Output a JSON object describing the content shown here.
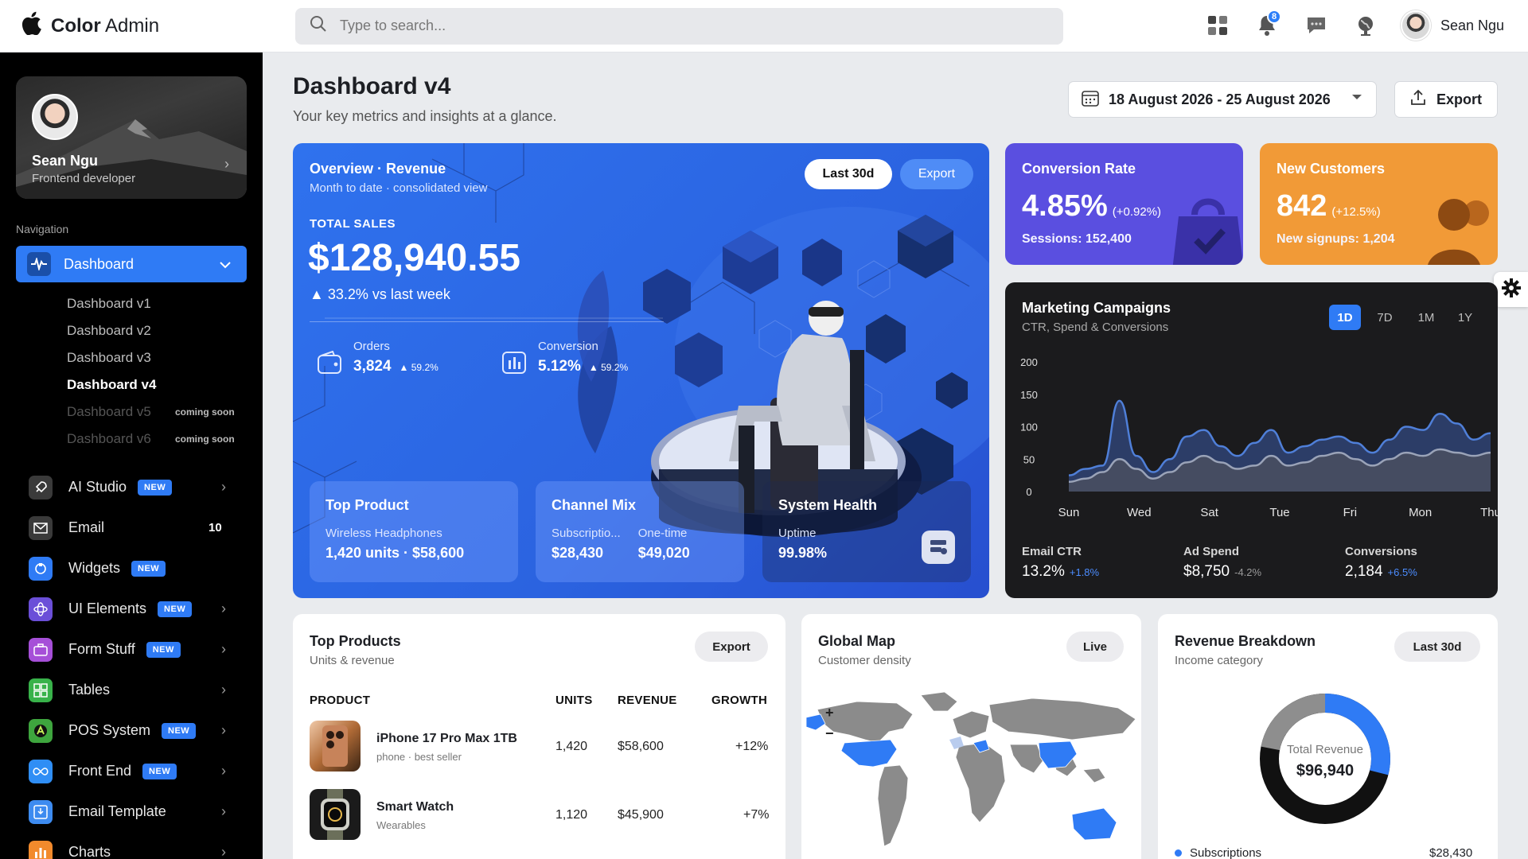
{
  "app": {
    "title_bold": "Color",
    "title_rest": "Admin"
  },
  "search": {
    "placeholder": "Type to search..."
  },
  "top": {
    "notifications_count": "8",
    "user_name": "Sean Ngu"
  },
  "sidebar": {
    "profile": {
      "name": "Sean Ngu",
      "role": "Frontend developer"
    },
    "nav_label": "Navigation",
    "active": {
      "label": "Dashboard"
    },
    "sub_items": [
      {
        "label": "Dashboard v1"
      },
      {
        "label": "Dashboard v2"
      },
      {
        "label": "Dashboard v3"
      },
      {
        "label": "Dashboard v4"
      },
      {
        "label": "Dashboard v5",
        "soon": "coming soon"
      },
      {
        "label": "Dashboard v6",
        "soon": "coming soon"
      }
    ],
    "menu": [
      {
        "label": "AI Studio",
        "badge": "NEW",
        "color": "#3a3a3a",
        "icon": "rocket-icon"
      },
      {
        "label": "Email",
        "count": "10",
        "color": "#3a3a3a",
        "icon": "envelope-icon"
      },
      {
        "label": "Widgets",
        "badge": "NEW",
        "color": "#2f7bf5",
        "icon": "widget-icon"
      },
      {
        "label": "UI Elements",
        "badge": "NEW",
        "color": "#6b4fd8",
        "icon": "atom-icon"
      },
      {
        "label": "Form Stuff",
        "badge": "NEW",
        "color": "#a64fd8",
        "icon": "briefcase-icon"
      },
      {
        "label": "Tables",
        "color": "#38b24a",
        "icon": "grid-icon"
      },
      {
        "label": "POS System",
        "badge": "NEW",
        "color": "#3ea53e",
        "icon": "pos-icon"
      },
      {
        "label": "Front End",
        "badge": "NEW",
        "color": "#2f8ef5",
        "icon": "infinity-icon"
      },
      {
        "label": "Email Template",
        "color": "#3d8bf0",
        "icon": "inbox-icon"
      },
      {
        "label": "Charts",
        "color": "#f28a2c",
        "icon": "chart-icon"
      }
    ],
    "labels": {
      "new": "NEW",
      "email_count": "10"
    }
  },
  "page": {
    "title": "Dashboard v4",
    "subtitle": "Your key metrics and insights at a glance.",
    "date_range": "18 August 2026 - 25 August 2026",
    "export": "Export"
  },
  "hero": {
    "title": "Overview · Revenue",
    "subtitle": "Month to date · consolidated view",
    "btn_primary": "Last 30d",
    "btn_secondary": "Export",
    "total_label": "TOTAL SALES",
    "total_value": "$128,940.55",
    "change": "▲ 33.2% vs last week",
    "orders": {
      "label": "Orders",
      "value": "3,824",
      "delta": "▲ 59.2%"
    },
    "conversion": {
      "label": "Conversion",
      "value": "5.12%",
      "delta": "▲ 59.2%"
    },
    "top_product": {
      "title": "Top Product",
      "line1": "Wireless Headphones",
      "line2": "1,420 units · $58,600"
    },
    "channel_mix": {
      "title": "Channel Mix",
      "a_label": "Subscriptio...",
      "a_value": "$28,430",
      "b_label": "One-time",
      "b_value": "$49,020"
    },
    "system_health": {
      "title": "System Health",
      "label": "Uptime",
      "value": "99.98%"
    }
  },
  "tiles": {
    "conversion": {
      "title": "Conversion Rate",
      "value": "4.85%",
      "delta": "(+0.92%)",
      "sub": "Sessions: 152,400",
      "color": "#5a4fe0"
    },
    "customers": {
      "title": "New Customers",
      "value": "842",
      "delta": "(+12.5%)",
      "sub": "New signups: 1,204",
      "color": "#f19a37"
    }
  },
  "marketing": {
    "title": "Marketing Campaigns",
    "subtitle": "CTR, Spend & Conversions",
    "ranges": [
      "1D",
      "7D",
      "1M",
      "1Y"
    ],
    "active_range": "1D",
    "kpis": [
      {
        "label": "Email CTR",
        "value": "13.2%",
        "delta": "+1.8%",
        "color": "#4c8dff"
      },
      {
        "label": "Ad Spend",
        "value": "$8,750",
        "delta": "-4.2%",
        "color": "#9b9b9b"
      },
      {
        "label": "Conversions",
        "value": "2,184",
        "delta": "+6.5%",
        "color": "#4c8dff"
      }
    ]
  },
  "chart_data": {
    "type": "area",
    "x": [
      "Sun",
      "Wed",
      "Sat",
      "Tue",
      "Fri",
      "Mon",
      "Thu"
    ],
    "yticks": [
      0,
      50,
      100,
      150,
      200
    ],
    "ylim": [
      0,
      200
    ],
    "series": [
      {
        "values": [
          25,
          35,
          40,
          140,
          55,
          30,
          50,
          85,
          95,
          70,
          55,
          75,
          95,
          60,
          70,
          80,
          85,
          75,
          60,
          80,
          100,
          95,
          120,
          105,
          80,
          90
        ]
      },
      {
        "values": [
          15,
          20,
          30,
          50,
          35,
          20,
          30,
          45,
          55,
          45,
          35,
          40,
          55,
          40,
          45,
          55,
          60,
          50,
          40,
          50,
          60,
          55,
          65,
          60,
          55,
          60
        ]
      }
    ]
  },
  "top_products": {
    "title": "Top Products",
    "subtitle": "Units & revenue",
    "button": "Export",
    "headers": [
      "PRODUCT",
      "UNITS",
      "REVENUE",
      "GROWTH"
    ],
    "rows": [
      {
        "name": "iPhone 17 Pro Max 1TB",
        "category": "phone · best seller",
        "units": "1,420",
        "revenue": "$58,600",
        "growth": "+12%"
      },
      {
        "name": "Smart Watch",
        "category": "Wearables",
        "units": "1,120",
        "revenue": "$45,900",
        "growth": "+7%"
      }
    ]
  },
  "global_map": {
    "title": "Global Map",
    "subtitle": "Customer density",
    "button": "Live",
    "zoom_in": "+",
    "zoom_out": "−"
  },
  "revenue_breakdown": {
    "title": "Revenue Breakdown",
    "subtitle": "Income category",
    "button": "Last 30d",
    "center_label": "Total Revenue",
    "center_value": "$96,940",
    "donut_fraction": 0.29,
    "legend": [
      {
        "label": "Subscriptions",
        "value": "$28,430"
      }
    ]
  }
}
